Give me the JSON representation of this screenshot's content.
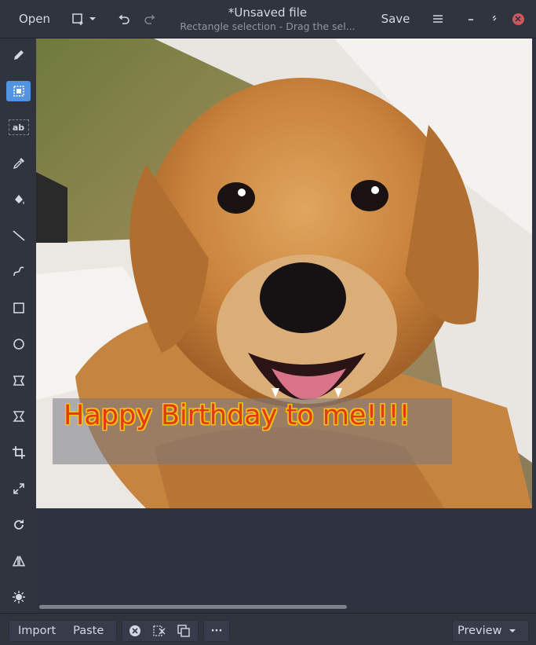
{
  "header": {
    "open_label": "Open",
    "title": "*Unsaved file",
    "subtitle": "Rectangle selection - Drag the sel...",
    "save_label": "Save",
    "icons": [
      "new-image-icon",
      "chevron-down-icon",
      "undo-icon",
      "redo-icon",
      "menu-icon",
      "minimize-icon",
      "maximize-icon",
      "close-icon"
    ]
  },
  "tools": [
    {
      "name": "pencil",
      "active": false
    },
    {
      "name": "rectangle-selection",
      "active": true
    },
    {
      "name": "text",
      "active": false,
      "label": "ab"
    },
    {
      "name": "color-picker",
      "active": false
    },
    {
      "name": "paint-bucket",
      "active": false
    },
    {
      "name": "line",
      "active": false
    },
    {
      "name": "curve",
      "active": false
    },
    {
      "name": "rectangle",
      "active": false
    },
    {
      "name": "circle",
      "active": false
    },
    {
      "name": "free-shape",
      "active": false
    },
    {
      "name": "skew",
      "active": false
    },
    {
      "name": "crop",
      "active": false
    },
    {
      "name": "scale",
      "active": false
    },
    {
      "name": "rotate",
      "active": false
    },
    {
      "name": "flip",
      "active": false
    },
    {
      "name": "filters",
      "active": false
    }
  ],
  "canvas": {
    "overlay_text": "Happy Birthday to me!!!!",
    "overlay_text_color": "#e33b10",
    "overlay_outline_color": "#f2c21a"
  },
  "footer": {
    "import_label": "Import",
    "paste_label": "Paste",
    "more_label": "···",
    "preview_label": "Preview"
  },
  "colors": {
    "accent": "#5294e2",
    "close": "#cc575d",
    "background": "#2f343f"
  }
}
